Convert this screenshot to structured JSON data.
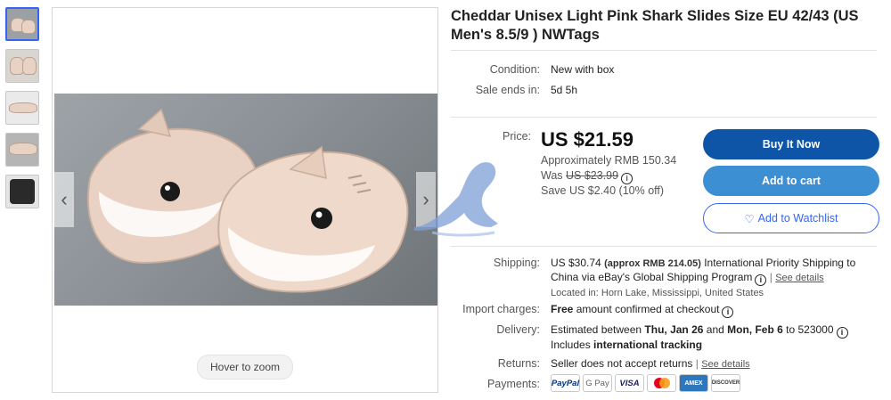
{
  "viewer": {
    "zoom_hint": "Hover to zoom"
  },
  "thumbnails": [
    {
      "name": "thumb-1"
    },
    {
      "name": "thumb-2"
    },
    {
      "name": "thumb-3"
    },
    {
      "name": "thumb-4"
    },
    {
      "name": "thumb-5"
    }
  ],
  "item": {
    "title_line1": "Cheddar Unisex Light Pink Shark Slides Size EU 42/43 (US",
    "title_line2": "Men's 8.5/9 ) NWTags",
    "condition_label": "Condition:",
    "condition_value": "New with box",
    "sale_ends_label": "Sale ends in:",
    "sale_ends_value": "5d 5h"
  },
  "pricing": {
    "price_label": "Price:",
    "price": "US $21.59",
    "approx": "Approximately RMB 150.34",
    "was_prefix": "Was ",
    "was_price": "US $23.99",
    "save": "Save US $2.40 (10% off)"
  },
  "actions": {
    "buy_now": "Buy It Now",
    "add_to_cart": "Add to cart",
    "watchlist": "Add to Watchlist"
  },
  "shipping": {
    "label": "Shipping:",
    "cost": "US $30.74",
    "approx": "(approx RMB 214.05)",
    "line1_rest": "International Priority Shipping to",
    "line2": "China via eBay's Global Shipping Program",
    "see_details": "See details",
    "location": "Located in: Horn Lake, Mississippi, United States"
  },
  "import": {
    "label": "Import charges:",
    "free": "Free",
    "rest": "amount confirmed at checkout"
  },
  "delivery": {
    "label": "Delivery:",
    "prefix": "Estimated between ",
    "date1": "Thu, Jan 26",
    "and": " and ",
    "date2": "Mon, Feb 6",
    "suffix": " to 523000",
    "includes": "Includes ",
    "tracking": "international tracking"
  },
  "returns": {
    "label": "Returns:",
    "text": "Seller does not accept returns",
    "see_details": "See details"
  },
  "payments": {
    "label": "Payments:",
    "methods": [
      "PayPal",
      "G Pay",
      "VISA",
      "Mastercard",
      "AMEX",
      "DISCOVER"
    ]
  },
  "colors": {
    "buy_now": "#0e54a7",
    "add_to_cart": "#3d8fd4",
    "link_blue": "#3665f3"
  }
}
